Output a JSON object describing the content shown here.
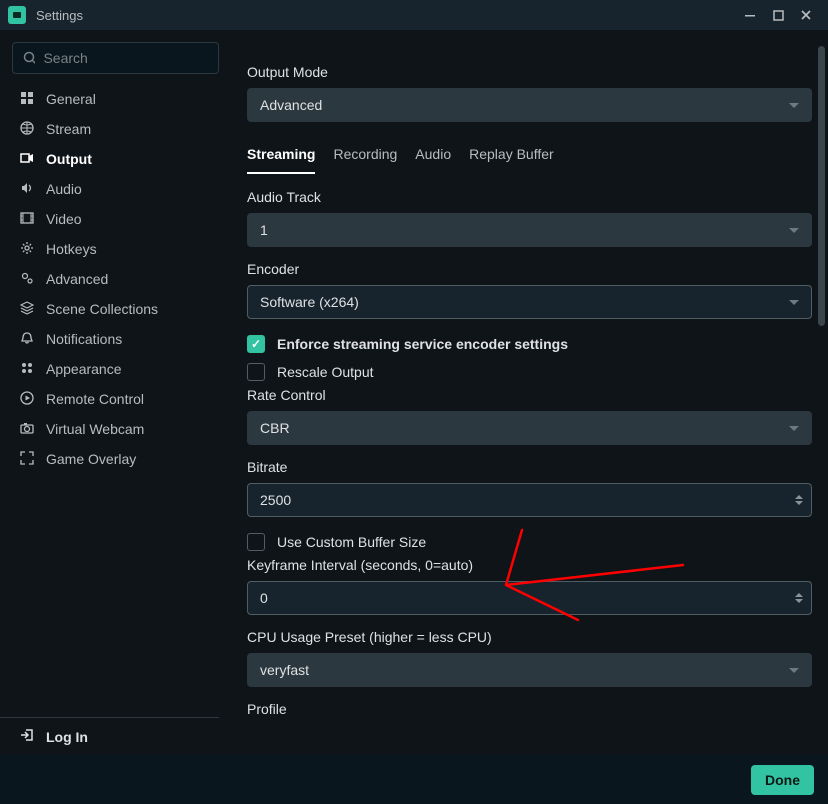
{
  "window": {
    "title": "Settings"
  },
  "search": {
    "placeholder": "Search"
  },
  "sidebar": {
    "items": [
      {
        "label": "General"
      },
      {
        "label": "Stream"
      },
      {
        "label": "Output",
        "active": true
      },
      {
        "label": "Audio"
      },
      {
        "label": "Video"
      },
      {
        "label": "Hotkeys"
      },
      {
        "label": "Advanced"
      },
      {
        "label": "Scene Collections"
      },
      {
        "label": "Notifications"
      },
      {
        "label": "Appearance"
      },
      {
        "label": "Remote Control"
      },
      {
        "label": "Virtual Webcam"
      },
      {
        "label": "Game Overlay"
      }
    ],
    "login": "Log In"
  },
  "main": {
    "output_mode_label": "Output Mode",
    "output_mode_value": "Advanced",
    "tabs": [
      {
        "label": "Streaming",
        "active": true
      },
      {
        "label": "Recording"
      },
      {
        "label": "Audio"
      },
      {
        "label": "Replay Buffer"
      }
    ],
    "audio_track_label": "Audio Track",
    "audio_track_value": "1",
    "encoder_label": "Encoder",
    "encoder_value": "Software (x264)",
    "enforce_label": "Enforce streaming service encoder settings",
    "enforce_checked": true,
    "rescale_label": "Rescale Output",
    "rescale_checked": false,
    "rate_control_label": "Rate Control",
    "rate_control_value": "CBR",
    "bitrate_label": "Bitrate",
    "bitrate_value": "2500",
    "custom_buffer_label": "Use Custom Buffer Size",
    "custom_buffer_checked": false,
    "keyframe_label": "Keyframe Interval (seconds, 0=auto)",
    "keyframe_value": "0",
    "cpu_preset_label": "CPU Usage Preset (higher = less CPU)",
    "cpu_preset_value": "veryfast",
    "profile_label": "Profile"
  },
  "footer": {
    "done": "Done"
  }
}
